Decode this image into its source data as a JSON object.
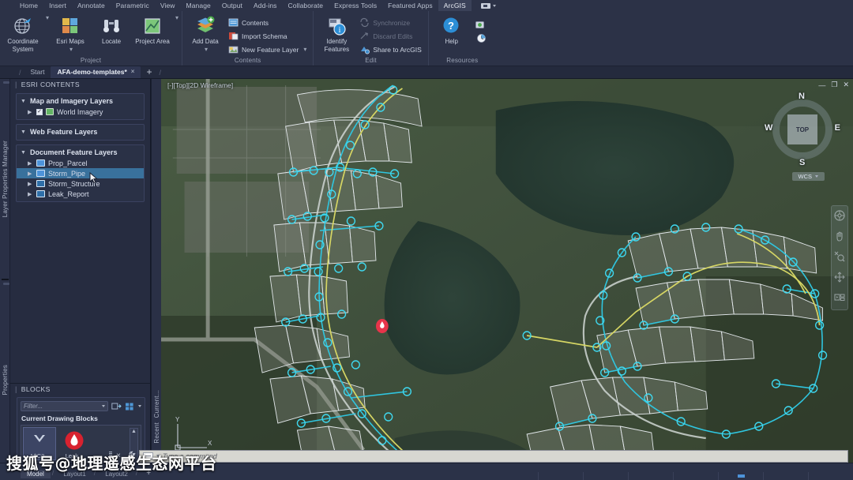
{
  "ribbon": {
    "tabs": [
      {
        "label": "Home",
        "active": false
      },
      {
        "label": "Insert",
        "active": false
      },
      {
        "label": "Annotate",
        "active": false
      },
      {
        "label": "Parametric",
        "active": false
      },
      {
        "label": "View",
        "active": false
      },
      {
        "label": "Manage",
        "active": false
      },
      {
        "label": "Output",
        "active": false
      },
      {
        "label": "Add-ins",
        "active": false
      },
      {
        "label": "Collaborate",
        "active": false
      },
      {
        "label": "Express Tools",
        "active": false
      },
      {
        "label": "Featured Apps",
        "active": false
      },
      {
        "label": "ArcGIS",
        "active": true
      }
    ],
    "panels": [
      {
        "title": "Project",
        "big_buttons": [
          {
            "label": "Coordinate System",
            "icon": "globe-icon",
            "has_dropdown": true
          },
          {
            "label": "Esri Maps",
            "icon": "basemap-tiles-icon",
            "has_dropdown": true
          },
          {
            "label": "Locate",
            "icon": "binoculars-icon",
            "has_dropdown": false
          },
          {
            "label": "Project Area",
            "icon": "project-area-icon",
            "has_dropdown": true
          }
        ],
        "small_buttons": []
      },
      {
        "title": "Contents",
        "big_buttons": [
          {
            "label": "Add Data",
            "icon": "add-data-layers-icon",
            "has_dropdown": true
          }
        ],
        "small_buttons": [
          {
            "label": "Contents",
            "icon": "contents-icon",
            "disabled": false,
            "has_dropdown": false
          },
          {
            "label": "Import Schema",
            "icon": "import-schema-icon",
            "disabled": false,
            "has_dropdown": false
          },
          {
            "label": "New Feature Layer",
            "icon": "new-feature-layer-icon",
            "disabled": false,
            "has_dropdown": true
          }
        ]
      },
      {
        "title": "Edit",
        "big_buttons": [
          {
            "label": "Identify Features",
            "icon": "identify-features-icon",
            "has_dropdown": false
          }
        ],
        "small_buttons": [
          {
            "label": "Synchronize",
            "icon": "synchronize-icon",
            "disabled": true,
            "has_dropdown": false
          },
          {
            "label": "Discard Edits",
            "icon": "discard-edits-icon",
            "disabled": true,
            "has_dropdown": false
          },
          {
            "label": "Share to ArcGIS",
            "icon": "share-to-arcgis-icon",
            "disabled": false,
            "has_dropdown": false
          }
        ]
      },
      {
        "title": "Resources",
        "big_buttons": [
          {
            "label": "Help",
            "icon": "help-question-icon",
            "has_dropdown": false
          }
        ],
        "small_buttons": [
          {
            "label": "",
            "icon": "screenshot-icon",
            "disabled": false,
            "has_dropdown": false
          },
          {
            "label": "",
            "icon": "clock-icon",
            "disabled": false,
            "has_dropdown": false
          }
        ]
      }
    ]
  },
  "doc_tabs": {
    "start_label": "Start",
    "file_label": "AFA-demo-templates*",
    "close_glyph": "×",
    "plus_glyph": "+"
  },
  "left_rail": {
    "top_label": "Layer Properties Manager",
    "bottom_label": "Properties"
  },
  "inner_rail": {
    "top_label": "Current...",
    "bottom_label": "Recent"
  },
  "esri_contents": {
    "title": "ESRI CONTENTS",
    "groups": [
      {
        "name": "Map and Imagery Layers",
        "expanded": true,
        "layers": [
          {
            "name": "World Imagery",
            "icon": "world-imagery-icon",
            "checked": true,
            "selected": false,
            "has_checkbox": true
          }
        ]
      },
      {
        "name": "Web Feature Layers",
        "expanded": true,
        "layers": []
      },
      {
        "name": "Document Feature Layers",
        "expanded": true,
        "layers": [
          {
            "name": "Prop_Parcel",
            "icon": "polygon-layer-icon",
            "checked": false,
            "selected": false,
            "has_checkbox": false
          },
          {
            "name": "Storm_Pipe",
            "icon": "line-layer-icon",
            "checked": false,
            "selected": true,
            "has_checkbox": false
          },
          {
            "name": "Storm_Structure",
            "icon": "point-layer-icon",
            "checked": false,
            "selected": false,
            "has_checkbox": false
          },
          {
            "name": "Leak_Report",
            "icon": "point-layer-icon",
            "checked": false,
            "selected": false,
            "has_checkbox": false
          }
        ]
      }
    ]
  },
  "blocks_panel": {
    "title": "BLOCKS",
    "filter_placeholder": "Filter...",
    "section_label": "Current Drawing Blocks",
    "toolbar_icons": [
      "insert-block-icon",
      "view-options-icon",
      "view-options-caret"
    ],
    "items": [
      {
        "label": "A$C2...",
        "icon": "block-preview-chevron",
        "selected": true
      },
      {
        "label": "Leak...",
        "icon": "leak-droplet-icon",
        "selected": false
      }
    ],
    "options_label": "Options",
    "options_icons": [
      "gear-icon",
      "expand-caret-icon"
    ]
  },
  "viewport": {
    "label": "[-][Top][2D Wireframe]",
    "window_controls": [
      "minimize",
      "restore",
      "close"
    ],
    "viewcube": {
      "top_face": "TOP",
      "north": "N",
      "south": "S",
      "east": "E",
      "west": "W",
      "wcs_label": "WCS"
    },
    "ucs": {
      "x_label": "X",
      "y_label": "Y"
    },
    "navbar_tools": [
      "full-navigation-wheel-icon",
      "pan-hand-icon",
      "zoom-extents-icon",
      "orbit-icon",
      "show-motion-icon"
    ]
  },
  "command_line": {
    "placeholder": "Type a command",
    "close_glyph": "×",
    "wrench_icon": "wrench-icon"
  },
  "status_bar": {
    "model_tabs": [
      {
        "label": "Model",
        "active": true
      },
      {
        "label": "Layout1",
        "active": false
      },
      {
        "label": "Layout2",
        "active": false
      }
    ]
  },
  "watermark": {
    "text": "搜狐号@地理遥感生态网平台"
  },
  "colors": {
    "accent_selection": "#39719c",
    "ribbon_bg": "#2c3247",
    "panel_bg": "#262c40",
    "pipe_cyan": "#35d3e8",
    "pipe_yellow": "#d8d86a",
    "leak_red": "#e8344a",
    "parcel_white": "#e8ecef"
  }
}
